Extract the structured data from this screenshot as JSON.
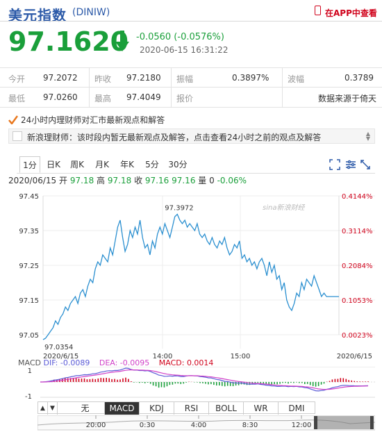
{
  "header": {
    "title": "美元指数",
    "code": "(DINIW)",
    "app_link": "在APP中查看",
    "price": "97.1620",
    "change": "-0.0560 (-0.0576%)",
    "time": "2020-06-15 16:31:22"
  },
  "stats": {
    "row1": [
      {
        "label": "今开",
        "value": "97.2072"
      },
      {
        "label": "昨收",
        "value": "97.2180"
      },
      {
        "label": "振幅",
        "value": "0.3897%"
      },
      {
        "label": "波幅",
        "value": "0.3789"
      }
    ],
    "row2": [
      {
        "label": "最低",
        "value": "97.0260"
      },
      {
        "label": "最高",
        "value": "97.4049"
      },
      {
        "label": "报价",
        "value": ""
      },
      {
        "label": "",
        "value": "数据来源于倚天"
      }
    ]
  },
  "news": {
    "heading": "24小时内理财师对汇市最新观点和解答",
    "text": "新浪理财师：该时段内暂无最新观点及解答，点击查看24小时之前的观点及解答"
  },
  "tabs": [
    "1分",
    "日K",
    "周K",
    "月K",
    "年K",
    "5分",
    "30分"
  ],
  "legend": {
    "date": "2020/06/15",
    "open_label": "开",
    "open": "97.18",
    "high_label": "高",
    "high": "97.18",
    "close_label": "收",
    "close": "97.16",
    "last": "97.16",
    "vol_label": "量",
    "vol": "0",
    "pct": "-0.06%"
  },
  "chart_data": [
    {
      "type": "line",
      "title": "",
      "ylim": [
        97.05,
        97.45
      ],
      "yticks": [
        "97.45",
        "97.35",
        "97.25",
        "97.15",
        "97.05"
      ],
      "right_ticks": [
        "0.4144%",
        "0.3114%",
        "0.2084%",
        "0.1053%",
        "0.0023%"
      ],
      "xticks": [
        "2020/6/15",
        "14:00",
        "15:00",
        "2020/6/15"
      ],
      "annotations": {
        "max_label": "97.3972",
        "min_label": "97.0354"
      },
      "watermark": "sina新浪财经",
      "x": [
        0,
        4,
        8,
        12,
        16,
        20,
        24,
        28,
        32,
        36,
        40,
        44,
        48,
        52,
        56,
        60,
        64,
        68,
        72,
        76,
        80,
        84,
        88,
        92,
        96,
        100,
        104,
        108,
        112,
        116,
        120,
        124,
        128,
        132,
        136,
        140,
        144,
        148,
        152,
        156,
        160,
        164,
        168,
        172,
        176,
        180,
        184,
        188,
        192,
        196,
        200,
        204,
        208,
        212,
        216,
        220,
        224,
        228,
        232,
        236,
        240,
        244,
        248,
        252,
        256,
        260,
        264,
        268,
        272,
        276,
        280,
        284,
        288,
        292,
        296,
        300,
        304,
        308,
        312,
        316,
        320,
        324,
        328,
        332,
        336,
        340,
        344,
        348,
        352,
        356,
        360,
        364,
        368,
        372,
        376,
        380,
        384,
        388,
        392,
        396,
        400,
        404,
        408,
        412,
        416,
        420,
        424,
        428,
        432,
        436,
        440,
        444,
        448,
        452,
        456,
        460,
        464,
        468,
        472,
        476
      ],
      "y": [
        97.036,
        97.04,
        97.05,
        97.06,
        97.07,
        97.09,
        97.08,
        97.1,
        97.11,
        97.13,
        97.12,
        97.14,
        97.15,
        97.16,
        97.14,
        97.17,
        97.18,
        97.16,
        97.19,
        97.21,
        97.2,
        97.24,
        97.26,
        97.25,
        97.28,
        97.27,
        97.26,
        97.3,
        97.28,
        97.32,
        97.36,
        97.38,
        97.33,
        97.29,
        97.31,
        97.35,
        97.33,
        97.36,
        97.34,
        97.38,
        97.33,
        97.3,
        97.31,
        97.28,
        97.32,
        97.3,
        97.34,
        97.36,
        97.34,
        97.37,
        97.35,
        97.33,
        97.36,
        97.39,
        97.397,
        97.38,
        97.37,
        97.38,
        97.36,
        97.37,
        97.36,
        97.35,
        97.37,
        97.34,
        97.33,
        97.34,
        97.32,
        97.31,
        97.33,
        97.31,
        97.3,
        97.32,
        97.31,
        97.33,
        97.3,
        97.28,
        97.29,
        97.31,
        97.3,
        97.32,
        97.27,
        97.28,
        97.26,
        97.27,
        97.25,
        97.26,
        97.24,
        97.26,
        97.27,
        97.25,
        97.22,
        97.26,
        97.23,
        97.25,
        97.21,
        97.22,
        97.18,
        97.2,
        97.15,
        97.13,
        97.12,
        97.14,
        97.17,
        97.16,
        97.2,
        97.18,
        97.21,
        97.2,
        97.19,
        97.22,
        97.2,
        97.18,
        97.16,
        97.17,
        97.16,
        97.16,
        97.16,
        97.16,
        97.16,
        97.16
      ]
    },
    {
      "type": "bar",
      "title": "MACD",
      "labels": {
        "dif": "DIF: -0.0089",
        "dea": "DEA: -0.0095",
        "macd": "MACD: 0.0014"
      },
      "yticks": [
        "1",
        "-1"
      ],
      "ylim": [
        -1.3,
        1.3
      ]
    }
  ],
  "indicator_tabs": [
    "无",
    "MACD",
    "KDJ",
    "RSI",
    "BOLL",
    "WR",
    "DMI"
  ],
  "navigator": {
    "ticks": [
      "20:00",
      "0:30",
      "4:00",
      "8:30",
      "12:00"
    ]
  },
  "colors": {
    "up": "#d0021b",
    "down": "#1a9f3a",
    "line": "#2a8fd0",
    "dif": "#5a5ad6",
    "dea": "#d040c8"
  }
}
